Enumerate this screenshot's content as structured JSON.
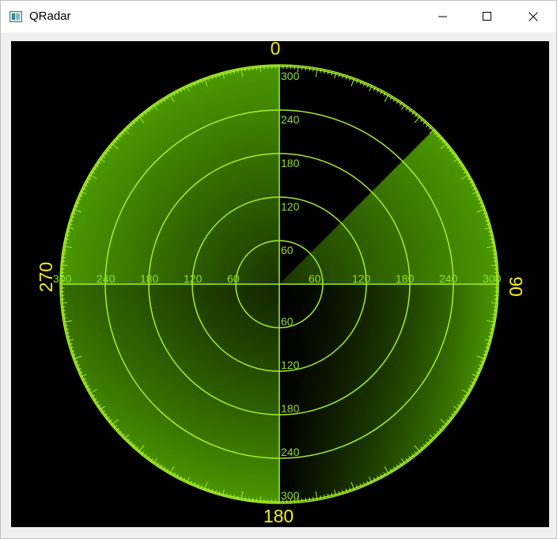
{
  "window": {
    "title": "QRadar",
    "app_icon": "qt-app-icon",
    "buttons": {
      "minimize_icon": "minimize-icon",
      "maximize_icon": "maximize-icon",
      "close_icon": "close-icon"
    }
  },
  "radar": {
    "ring_labels": [
      "60",
      "120",
      "180",
      "240",
      "300"
    ],
    "bearing_labels": {
      "north": "0",
      "east": "90",
      "south": "180",
      "west": "270"
    },
    "sweep_bearing_deg": 45,
    "colors": {
      "background": "#000000",
      "grid": "#a7ee2a",
      "ring_label": "#8fe028",
      "bearing_label": "#f6f019",
      "sweep": "#4a9800"
    }
  }
}
